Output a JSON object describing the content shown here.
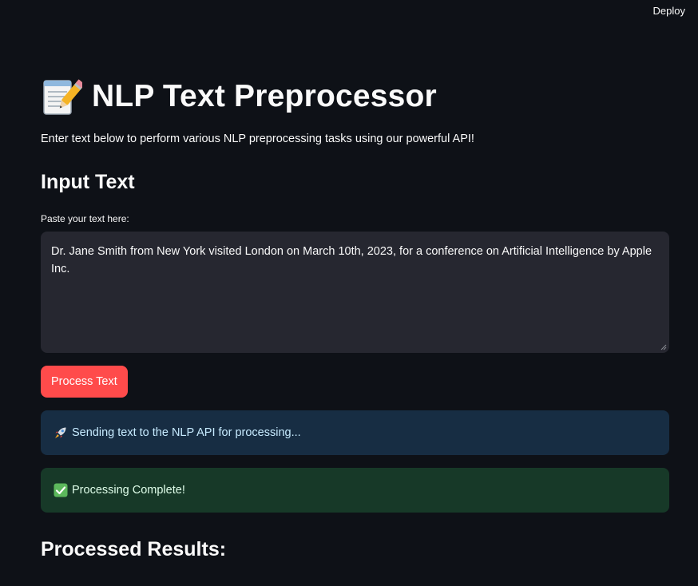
{
  "header": {
    "deploy_label": "Deploy"
  },
  "page": {
    "title": "NLP Text Preprocessor",
    "title_icon": "memo-pencil-icon",
    "subtitle": "Enter text below to perform various NLP preprocessing tasks using our powerful API!"
  },
  "input_section": {
    "heading": "Input Text",
    "field_label": "Paste your text here:",
    "field_value": "Dr. Jane Smith from New York visited London on March 10th, 2023, for a conference on Artificial Intelligence by Apple Inc."
  },
  "actions": {
    "process_label": "Process Text"
  },
  "status": {
    "info_icon": "rocket-icon",
    "info_text": "Sending text to the NLP API for processing...",
    "success_icon": "check-mark-icon",
    "success_text": "Processing Complete!"
  },
  "results": {
    "heading": "Processed Results:"
  },
  "colors": {
    "background": "#0e1117",
    "accent_button": "#ff4b4b",
    "textarea_bg": "#262730",
    "info_bg": "#172d43",
    "success_bg": "#173928"
  }
}
